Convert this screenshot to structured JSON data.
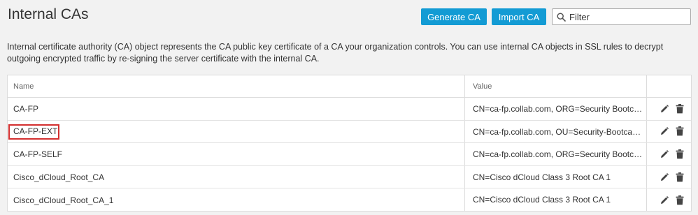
{
  "header": {
    "title": "Internal CAs",
    "generate_label": "Generate CA",
    "import_label": "Import CA",
    "filter_placeholder": "Filter"
  },
  "description": "Internal certificate authority (CA) object represents the CA public key certificate of a CA your organization controls. You can use internal CA objects in SSL rules to decrypt outgoing encrypted traffic by re-signing the server certificate with the internal CA.",
  "table": {
    "columns": {
      "name": "Name",
      "value": "Value"
    },
    "rows": [
      {
        "name": "CA-FP",
        "value": "CN=ca-fp.collab.com, ORG=Security Bootcamp...",
        "highlighted": false
      },
      {
        "name": "CA-FP-EXT",
        "value": "CN=ca-fp.collab.com, OU=Security-Bootcamp,...",
        "highlighted": true
      },
      {
        "name": "CA-FP-SELF",
        "value": "CN=ca-fp.collab.com, ORG=Security Bootcamp...",
        "highlighted": false
      },
      {
        "name": "Cisco_dCloud_Root_CA",
        "value": "CN=Cisco dCloud Class 3 Root CA 1",
        "highlighted": false
      },
      {
        "name": "Cisco_dCloud_Root_CA_1",
        "value": "CN=Cisco dCloud Class 3 Root CA 1",
        "highlighted": false
      }
    ]
  },
  "icons": {
    "edit": "pencil-icon",
    "delete": "trash-icon",
    "search": "search-icon"
  },
  "colors": {
    "accent": "#139bd4",
    "highlight": "#d32f2f"
  }
}
